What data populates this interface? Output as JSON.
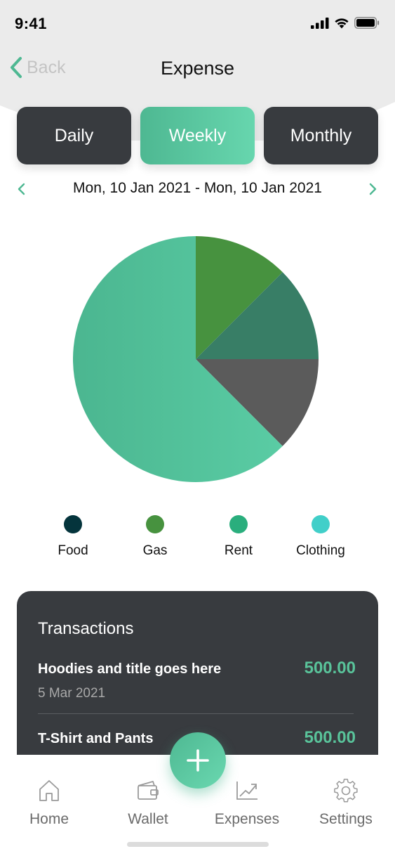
{
  "status_bar": {
    "time": "9:41",
    "signal_icon": "cellular-signal-icon",
    "wifi_icon": "wifi-icon",
    "battery_icon": "battery-icon"
  },
  "nav": {
    "back_label": "Back",
    "back_icon": "chevron-left-icon",
    "title": "Expense"
  },
  "segments": [
    {
      "label": "Daily",
      "active": false
    },
    {
      "label": "Weekly",
      "active": true
    },
    {
      "label": "Monthly",
      "active": false
    }
  ],
  "date_range": {
    "label": "Mon, 10 Jan 2021 - Mon, 10 Jan 2021",
    "prev_icon": "chevron-left-icon",
    "next_icon": "chevron-right-icon"
  },
  "chart_data": {
    "type": "pie",
    "slices": [
      {
        "value": 12.5,
        "color": "#47923f"
      },
      {
        "value": 12.5,
        "color": "#387e66"
      },
      {
        "value": 12.5,
        "color": "#5b5b5b"
      },
      {
        "value": 62.5,
        "color": "#52c29b"
      }
    ]
  },
  "legend": [
    {
      "label": "Food",
      "color": "#04343c"
    },
    {
      "label": "Gas",
      "color": "#47923f"
    },
    {
      "label": "Rent",
      "color": "#2aae7d"
    },
    {
      "label": "Clothing",
      "color": "#41cfc9"
    }
  ],
  "transactions": {
    "title": "Transactions",
    "items": [
      {
        "name": "Hoodies and title goes here",
        "date": "5 Mar 2021",
        "amount": "500.00"
      },
      {
        "name": "T-Shirt and Pants",
        "date": "",
        "amount": "500.00"
      }
    ]
  },
  "fab": {
    "icon": "plus-icon"
  },
  "tab_bar": [
    {
      "label": "Home",
      "icon": "home-icon"
    },
    {
      "label": "Wallet",
      "icon": "wallet-icon"
    },
    {
      "label": "Expenses",
      "icon": "chart-trend-icon"
    },
    {
      "label": "Settings",
      "icon": "gear-icon"
    }
  ],
  "colors": {
    "accent": "#4eb892",
    "dark_card": "#383b3f",
    "header_bg": "#ebebeb"
  }
}
